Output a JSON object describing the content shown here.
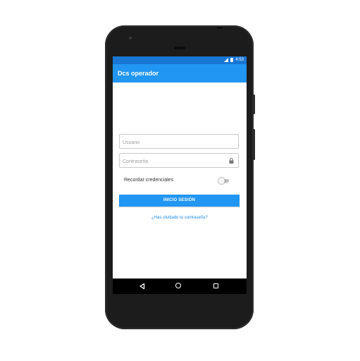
{
  "status_bar": {
    "time": "4:53"
  },
  "app_bar": {
    "title": "Dcs operador",
    "color": "#2196f3"
  },
  "form": {
    "username": {
      "value": "",
      "placeholder": "Usuario"
    },
    "password": {
      "value": "",
      "placeholder": "Contraseña",
      "icon": "lock-icon"
    },
    "remember": {
      "label": "Recordar credenciales",
      "checked": false
    },
    "login_button": {
      "label": "INICIO SESIÓN"
    },
    "forgot_link": {
      "label": "¿Has olvidado tu contraseña?"
    }
  },
  "nav_bar": {
    "icons": [
      "back-icon",
      "home-icon",
      "recents-icon"
    ]
  }
}
